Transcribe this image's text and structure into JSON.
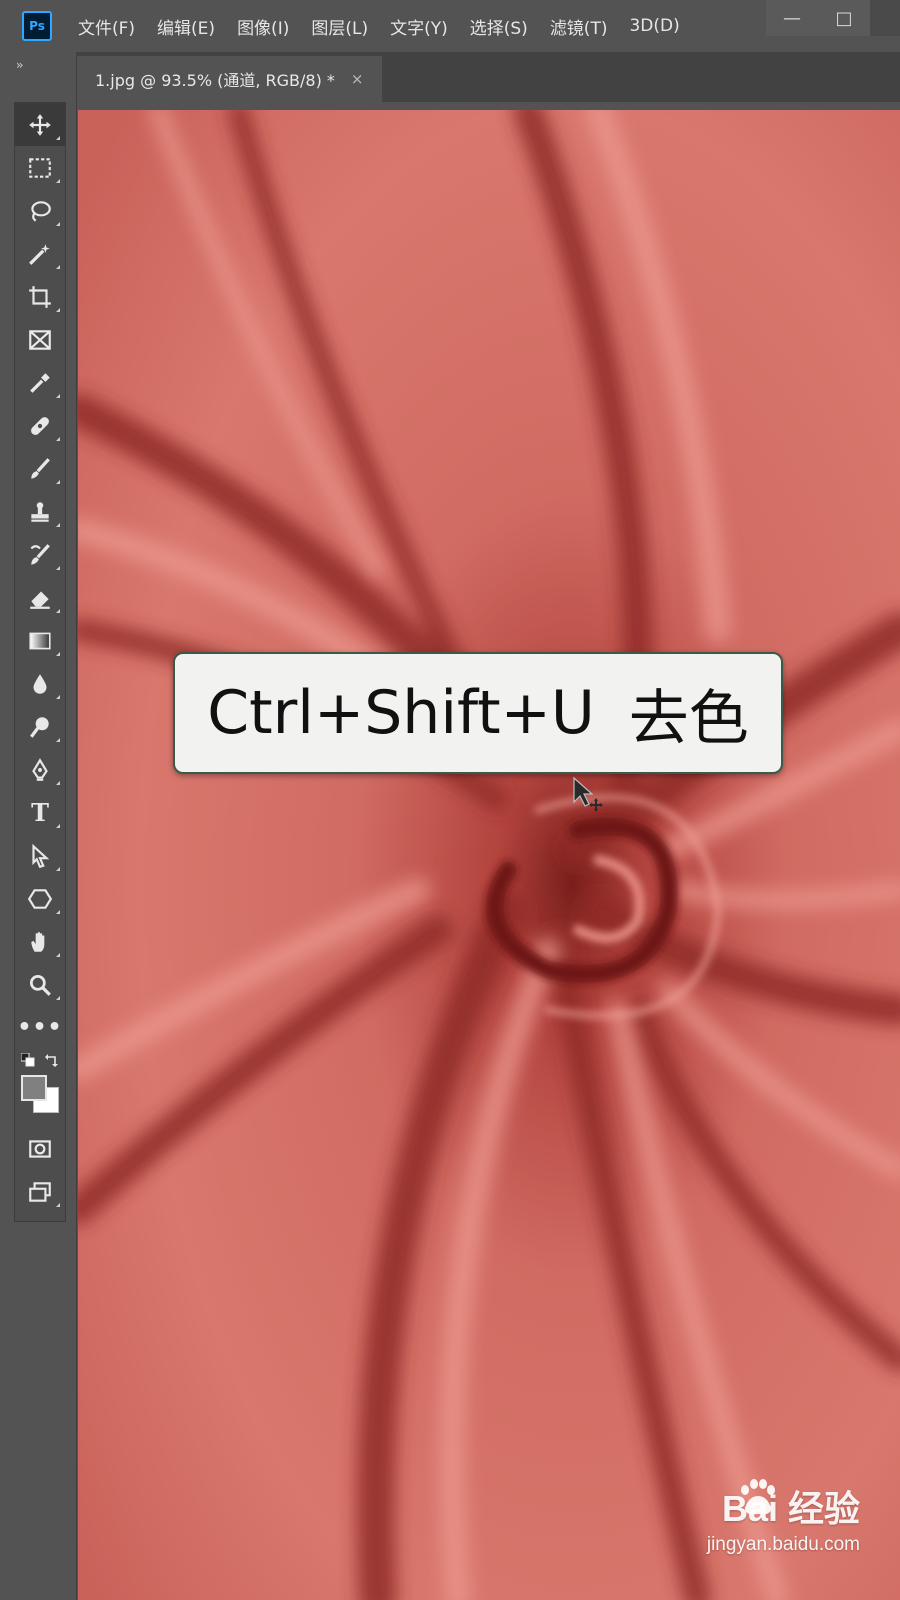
{
  "app": {
    "logo_text": "Ps",
    "menu": [
      "文件(F)",
      "编辑(E)",
      "图像(I)",
      "图层(L)",
      "文字(Y)",
      "选择(S)",
      "滤镜(T)",
      "3D(D)"
    ],
    "window_controls": {
      "minimize": "—",
      "maximize": "□"
    }
  },
  "panel": {
    "collapse_glyph": "››",
    "tools": [
      {
        "name": "move-tool",
        "icon": "move-icon"
      },
      {
        "name": "marquee-tool",
        "icon": "rect-marquee-icon"
      },
      {
        "name": "lasso-tool",
        "icon": "lasso-icon"
      },
      {
        "name": "magic-wand-tool",
        "icon": "magic-wand-icon"
      },
      {
        "name": "crop-tool",
        "icon": "crop-icon"
      },
      {
        "name": "frame-tool",
        "icon": "frame-icon"
      },
      {
        "name": "eyedropper-tool",
        "icon": "eyedropper-icon"
      },
      {
        "name": "healing-tool",
        "icon": "bandage-icon"
      },
      {
        "name": "brush-tool",
        "icon": "brush-icon"
      },
      {
        "name": "stamp-tool",
        "icon": "stamp-icon"
      },
      {
        "name": "history-brush-tool",
        "icon": "history-brush-icon"
      },
      {
        "name": "eraser-tool",
        "icon": "eraser-icon"
      },
      {
        "name": "gradient-tool",
        "icon": "gradient-icon"
      },
      {
        "name": "blur-tool",
        "icon": "drop-icon"
      },
      {
        "name": "dodge-tool",
        "icon": "dodge-icon"
      },
      {
        "name": "pen-tool",
        "icon": "pen-icon"
      },
      {
        "name": "type-tool",
        "icon": "type-icon",
        "label": "T"
      },
      {
        "name": "path-select-tool",
        "icon": "arrow-icon"
      },
      {
        "name": "shape-tool",
        "icon": "hexagon-icon"
      },
      {
        "name": "hand-tool",
        "icon": "hand-icon"
      },
      {
        "name": "zoom-tool",
        "icon": "magnifier-icon"
      }
    ],
    "more_label": "•••",
    "colors": {
      "foreground": "#808080",
      "background": "#ffffff"
    }
  },
  "document": {
    "tab_title": "1.jpg @ 93.5% (通道, RGB/8) *",
    "close_glyph": "×"
  },
  "overlay": {
    "shortcut_keys": "Ctrl+Shift+U",
    "shortcut_action": "去色"
  },
  "watermark": {
    "brand": "Bai  经验",
    "url": "jingyan.baidu.com"
  }
}
